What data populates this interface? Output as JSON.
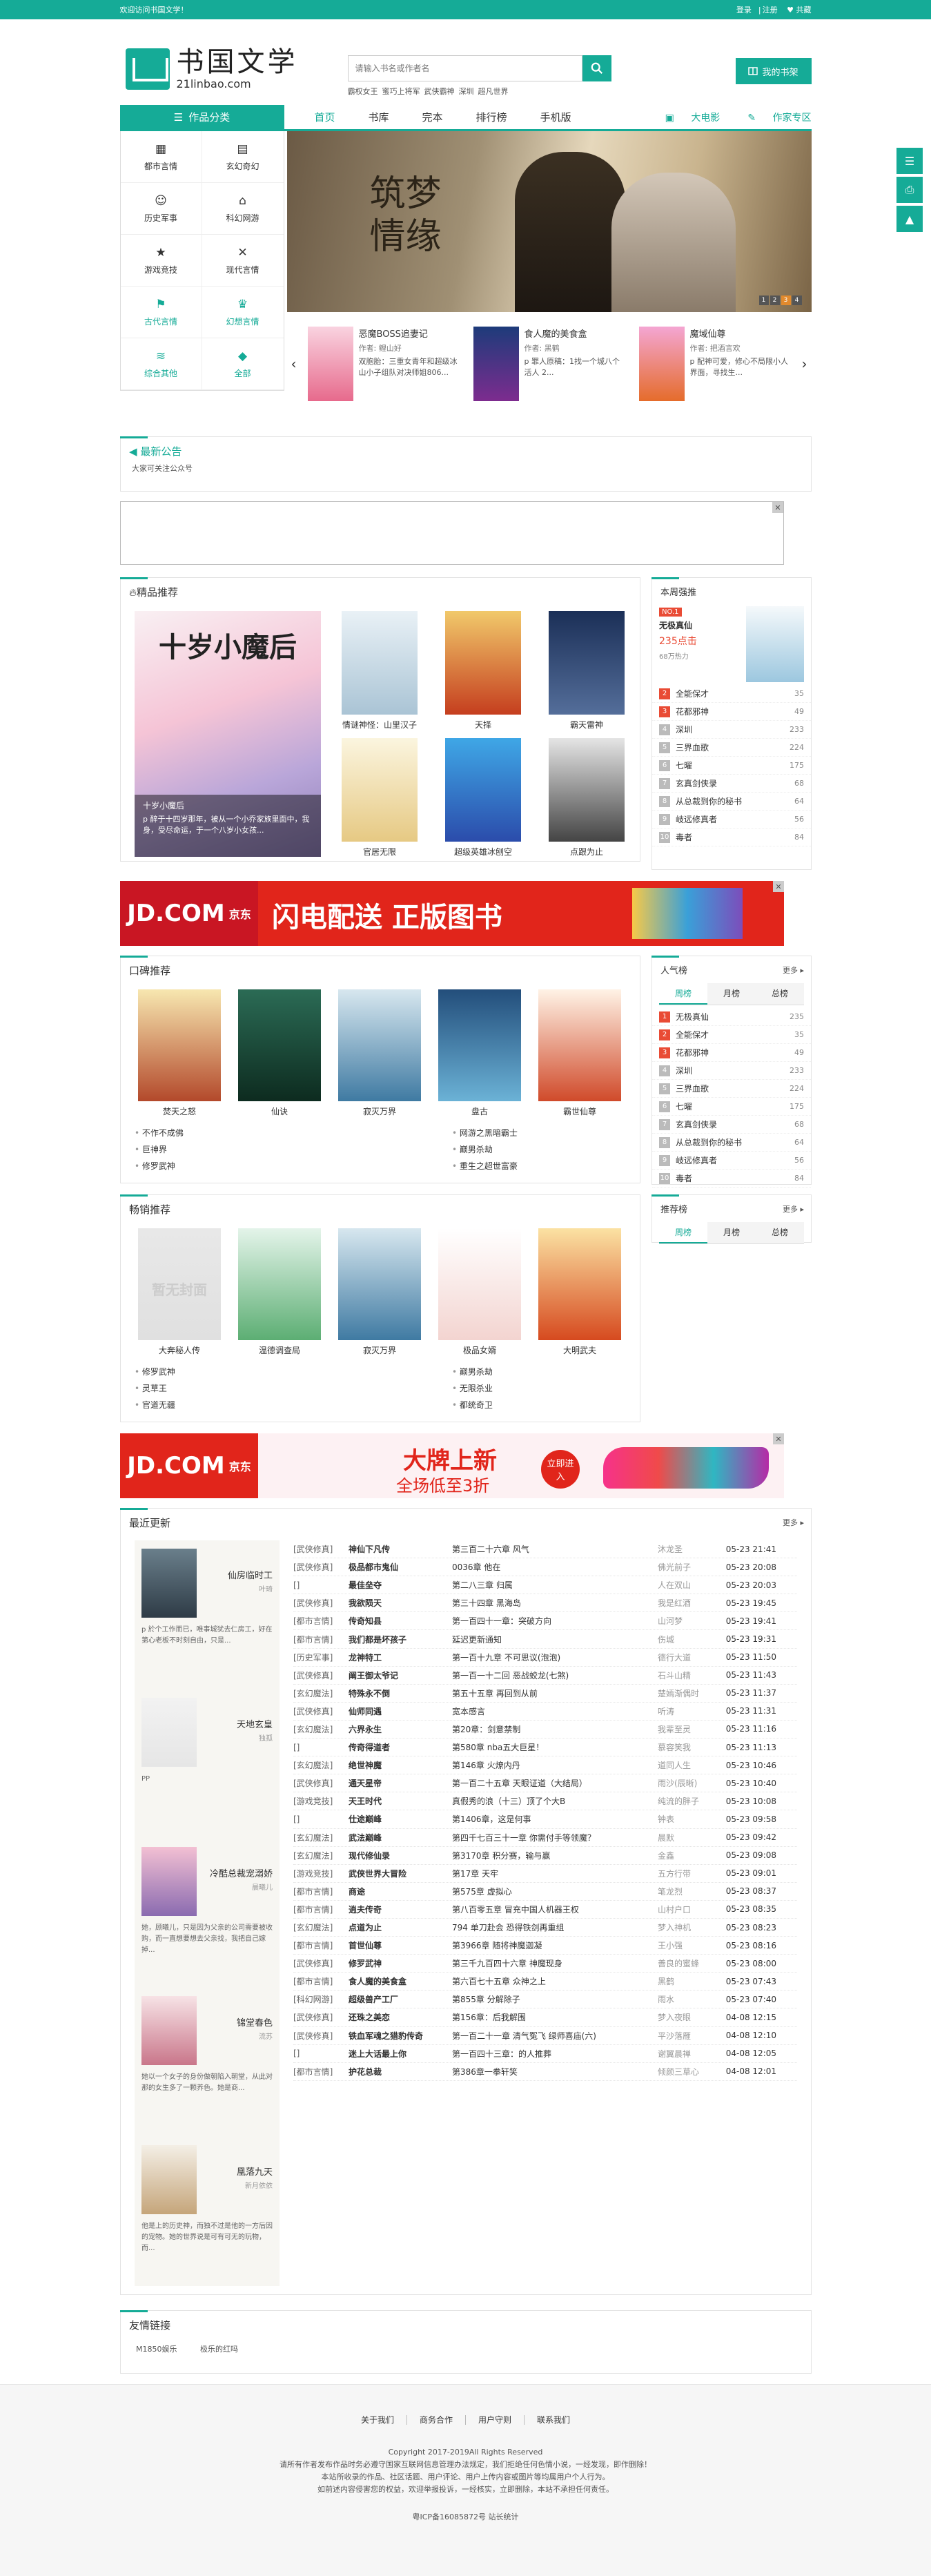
{
  "topbar": {
    "welcome": "欢迎访问书国文学！",
    "login": "登录",
    "register": "注册",
    "favorite": "共藏"
  },
  "logo": {
    "cn": "书国文学",
    "en": "21linbao.com"
  },
  "search": {
    "placeholder": "请输入书名或作者名",
    "hotwords": [
      "霸权女王",
      "蜜巧上将军",
      "武侠霸神",
      "深圳",
      "超凡世界"
    ]
  },
  "mybook": "我的书架",
  "nav": {
    "category": "作品分类",
    "items": [
      "首页",
      "书库",
      "完本",
      "排行榜",
      "手机版"
    ],
    "right": [
      "大电影",
      "作家专区"
    ]
  },
  "sidenav": [
    {
      "label": "都市言情",
      "icon": "book-icon"
    },
    {
      "label": "玄幻奇幻",
      "icon": "grid-icon"
    },
    {
      "label": "历史军事",
      "icon": "user-icon"
    },
    {
      "label": "科幻网游",
      "icon": "home-icon"
    },
    {
      "label": "游戏竞技",
      "icon": "star-icon"
    },
    {
      "label": "现代言情",
      "icon": "cross-icon"
    },
    {
      "label": "古代言情",
      "icon": "flag-icon"
    },
    {
      "label": "幻想言情",
      "icon": "crown-icon"
    },
    {
      "label": "综合其他",
      "icon": "layers-icon"
    },
    {
      "label": "全部",
      "icon": "diamond-icon"
    }
  ],
  "banner": {
    "title": "筑梦情缘",
    "dots": [
      "1",
      "2",
      "3",
      "4"
    ]
  },
  "carousel": [
    {
      "title": "恶魔BOSS追妻记",
      "author": "作者: 鲤山好",
      "desc": "双胞胎：三重女青年和超级冰山小子组队对决师姐806..."
    },
    {
      "title": "食人魔的美食盒",
      "author": "作者: 黑鹤",
      "desc": "p 罪人原稿：1找一个城八个活人 2..."
    },
    {
      "title": "魔域仙尊",
      "author": "作者: 把酒言欢",
      "desc": "p 配神可爱，修心不局限小人界面，寻找生..."
    }
  ],
  "notice": {
    "title": "最新公告",
    "text": "大家可关注公众号"
  },
  "featured": {
    "title": "精品推荐",
    "main_title": "十岁小魔后",
    "main_caption": "十岁小魔后",
    "main_desc": "p 醉于十四岁那年，被从一个小乔家族里面中，我身，受尽命运，于一个八岁小女孩...",
    "books": [
      "情谜神怪：山里汉子",
      "天择",
      "霸天雷神",
      "官居无限",
      "超级英雄冰刨空",
      "点跟为止"
    ]
  },
  "weekly": {
    "title": "本周强推",
    "top": {
      "badge": "NO.1",
      "name": "无极真仙",
      "count": "235点击",
      "sub": "68万热力"
    },
    "list": [
      {
        "n": "2",
        "name": "全能保才",
        "c": "35"
      },
      {
        "n": "3",
        "name": "花都邪神",
        "c": "49"
      },
      {
        "n": "4",
        "name": "深圳",
        "c": "233"
      },
      {
        "n": "5",
        "name": "三界血歌",
        "c": "224"
      },
      {
        "n": "6",
        "name": "七曜",
        "c": "175"
      },
      {
        "n": "7",
        "name": "玄真剑侠录",
        "c": "68"
      },
      {
        "n": "8",
        "name": "从总裁到你的秘书",
        "c": "64"
      },
      {
        "n": "9",
        "name": "岐远修真者",
        "c": "56"
      },
      {
        "n": "10",
        "name": "毒者",
        "c": "84"
      }
    ]
  },
  "ad1": {
    "brand": "JD.COM",
    "brand_cn": "京东",
    "slogan": "闪电配送 正版图书"
  },
  "praise": {
    "title": "口碑推荐",
    "books": [
      "焚天之怒",
      "仙诀",
      "寂灭万界",
      "盘古",
      "霸世仙尊"
    ],
    "list_left": [
      "不作不成佛",
      "巨神界",
      "修罗武神"
    ],
    "list_right": [
      "网游之黑暗霸士",
      "巅男杀劫",
      "重生之超世富豪"
    ]
  },
  "popular": {
    "title": "人气榜",
    "more": "更多",
    "tabs": [
      "周榜",
      "月榜",
      "总榜"
    ],
    "list": [
      {
        "n": "1",
        "name": "无极真仙",
        "c": "235"
      },
      {
        "n": "2",
        "name": "全能保才",
        "c": "35"
      },
      {
        "n": "3",
        "name": "花都邪神",
        "c": "49"
      },
      {
        "n": "4",
        "name": "深圳",
        "c": "233"
      },
      {
        "n": "5",
        "name": "三界血歌",
        "c": "224"
      },
      {
        "n": "6",
        "name": "七曜",
        "c": "175"
      },
      {
        "n": "7",
        "name": "玄真剑侠录",
        "c": "68"
      },
      {
        "n": "8",
        "name": "从总裁到你的秘书",
        "c": "64"
      },
      {
        "n": "9",
        "name": "岐远修真者",
        "c": "56"
      },
      {
        "n": "10",
        "name": "毒者",
        "c": "84"
      }
    ]
  },
  "bestseller": {
    "title": "畅销推荐",
    "books": [
      "大奔秘人传",
      "温德调查局",
      "寂灭万界",
      "极品女婿",
      "大明武夫"
    ],
    "cover1": "暂无封面",
    "list_left": [
      "修罗武神",
      "灵草王",
      "官道无疆"
    ],
    "list_right": [
      "巅男杀劫",
      "无限杀业",
      "都统奇卫"
    ]
  },
  "recommend": {
    "title": "推荐榜",
    "more": "更多",
    "tabs": [
      "周榜",
      "月榜",
      "总榜"
    ]
  },
  "ad2": {
    "brand": "JD.COM",
    "brand_cn": "京东",
    "slogan": "大牌上新",
    "sub": "全场低至3折",
    "cta": "立即进入"
  },
  "recent": {
    "title": "最近更新",
    "more": "更多",
    "side": [
      {
        "title": "仙房临时工",
        "author": "叶琦",
        "desc": "p 於个工作而已，唯事城犹去仁房工，好在第心老板不时刻自由，只是..."
      },
      {
        "title": "天地玄皇",
        "author": "独孤",
        "desc": "PP"
      },
      {
        "title": "冷酷总裁宠溺娇",
        "author": "晨曦儿",
        "desc": "她，顾曦儿，只是因为父亲的公司需要被收购，而一直想要想去父亲找，我把自己嫁掉..."
      },
      {
        "title": "锦堂春色",
        "author": "流苏",
        "desc": "她以一个女子的身份做朝陷入朝堂，从此对那的女生多了一颗养色。她是商..."
      },
      {
        "title": "凰落九天",
        "author": "新月依依",
        "desc": "他是上的历史神，而独不过是他的一方后因的宠物。她的世界说是可有可无的玩物，而..."
      }
    ],
    "rows": [
      [
        "[武侠修真]",
        "神仙下凡传",
        "第三百二十六章 风气",
        "沐龙圣",
        "05-23 21:41"
      ],
      [
        "[武侠修真]",
        "极品都市鬼仙",
        "0036章 他在",
        "佛光前子",
        "05-23 20:08"
      ],
      [
        "[]",
        "最佳垒夺",
        "第二八三章 归属",
        "人在双山",
        "05-23 20:03"
      ],
      [
        "[武侠修真]",
        "我欲陨天",
        "第三十四章 黑海岛",
        "我是红酒",
        "05-23 19:45"
      ],
      [
        "[都市言情]",
        "传奇知县",
        "第一百四十一章：突破方向",
        "山河梦",
        "05-23 19:41"
      ],
      [
        "[都市言情]",
        "我们都是坏孩子",
        "延迟更新通知",
        "伤城",
        "05-23 19:31"
      ],
      [
        "[历史军事]",
        "龙神特工",
        "第一百十九章 不可思议(泡泡)",
        "德行大道",
        "05-23 11:50"
      ],
      [
        "[武侠修真]",
        "阐王御太爷记",
        "第一百一十二回 恶战蛟龙(七煞)",
        "石斗山精",
        "05-23 11:43"
      ],
      [
        "[玄幻魔法]",
        "特殊永不倒",
        "第五十五章 再回到从前",
        "楚嫣渐偶时",
        "05-23 11:37"
      ],
      [
        "[武侠修真]",
        "仙师同遇",
        "宽本感言",
        "听涛",
        "05-23 11:31"
      ],
      [
        "[玄幻魔法]",
        "六界永生",
        "第20章：剑意禁制",
        "我辈至灵",
        "05-23 11:16"
      ],
      [
        "[]",
        "传奇得道者",
        "第580章 nba五大巨星！",
        "慕容笑我",
        "05-23 11:13"
      ],
      [
        "[玄幻魔法]",
        "绝世神魔",
        "第146章 火燎内丹",
        "道同人生",
        "05-23 10:46"
      ],
      [
        "[武侠修真]",
        "通天星帝",
        "第一百二十五章 天眼证道（大结局）",
        "雨沙(辰晰)",
        "05-23 10:40"
      ],
      [
        "[游戏竞技]",
        "天王时代",
        "真假秀的浪（十三）顶了个大B",
        "纯流的胖子",
        "05-23 10:08"
      ],
      [
        "[]",
        "仕途巅峰",
        "第1406章，这是何事",
        "钟表",
        "05-23 09:58"
      ],
      [
        "[玄幻魔法]",
        "武法巅峰",
        "第四千七百三十一章 你需付手等领魔？",
        "晨默",
        "05-23 09:42"
      ],
      [
        "[玄幻魔法]",
        "现代修仙录",
        "第3170章 积分赛，输与赢",
        "金鑫",
        "05-23 09:08"
      ],
      [
        "[游戏竞技]",
        "武侠世界大冒险",
        "第17章 天牢",
        "五方行带",
        "05-23 09:01"
      ],
      [
        "[都市言情]",
        "商途",
        "第575章 虚拟心",
        "笔龙烈",
        "05-23 08:37"
      ],
      [
        "[都市言情]",
        "逍夫传奇",
        "第八百零五章 冒充中国人机器王权",
        "山村户口",
        "05-23 08:35"
      ],
      [
        "[玄幻魔法]",
        "点道为止",
        "794 单刀赴会 恐得铁剑再重组",
        "梦入神机",
        "05-23 08:23"
      ],
      [
        "[都市言情]",
        "首世仙尊",
        "第3966章 随将神魔迦凝",
        "王小强",
        "05-23 08:16"
      ],
      [
        "[武侠修真]",
        "修罗武神",
        "第三千九百四十六章 神魔现身",
        "善良的蜜蜂",
        "05-23 08:00"
      ],
      [
        "[都市言情]",
        "食人魔的美食盒",
        "第六百七十五章 众神之上",
        "黑鹤",
        "05-23 07:43"
      ],
      [
        "[科幻网游]",
        "超级兽产工厂",
        "第855章 分解除子",
        "雨水",
        "05-23 07:40"
      ],
      [
        "[武侠修真]",
        "还珠之美恋",
        "第156章：后我解围",
        "梦入夜眼",
        "04-08 12:15"
      ],
      [
        "[武侠修真]",
        "铁血军魂之猎豹传奇",
        "第一百二十一章 清气冤飞 绿师喜庙(六)",
        "平沙落雁",
        "04-08 12:10"
      ],
      [
        "[]",
        "迷上大话最上你",
        "第一百四十三章：的人推葬",
        "谢翼晨禅",
        "04-08 12:05"
      ],
      [
        "[都市言情]",
        "护花总裁",
        "第386章一拳轩笑",
        "倾颜三草心",
        "04-08 12:01"
      ]
    ]
  },
  "friends": {
    "title": "友情链接",
    "links": [
      "M1850娱乐",
      "极乐的红吗"
    ]
  },
  "footer": {
    "links": [
      "关于我们",
      "商务合作",
      "用户守则",
      "联系我们"
    ],
    "copyright": "Copyright 2017-2019All Rights Reserved",
    "line1": "请所有作者发布作品时务必遵守国家互联网信息管理办法规定，我们拒绝任何色情小说，一经发现，即作删除！",
    "line2": "本站所收录的作品、社区话题、用户评论、用户上传内容或图片等均属用户个人行为。",
    "line3": "如前述内容侵害您的权益，欢迎举报投诉，一经核实，立即删除，本站不承担任何责任。",
    "icp": "粤ICP备16085872号",
    "stats": "站长统计"
  },
  "colors": {
    "accent": "#15ab97",
    "jd_red": "#e1251b"
  }
}
